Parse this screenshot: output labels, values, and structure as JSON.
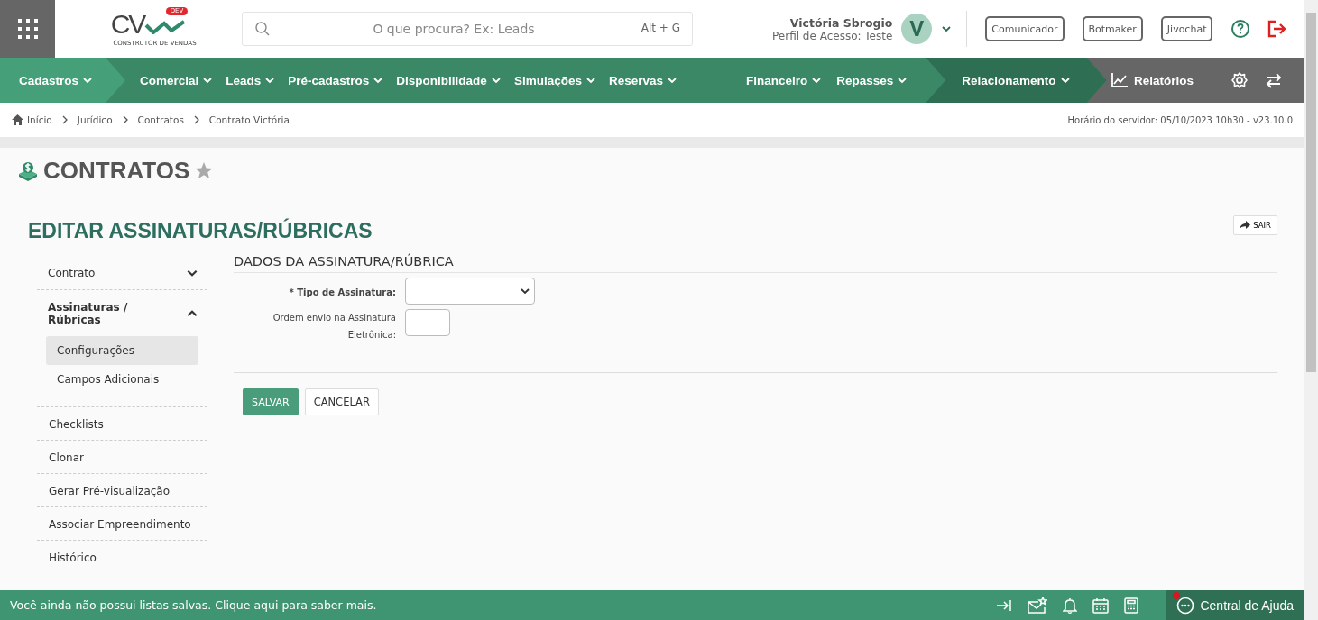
{
  "header": {
    "logo": {
      "text": "CV",
      "badge": "DEV",
      "caption": "CONSTRUTOR DE VENDAS"
    },
    "search": {
      "placeholder": "O que procura? Ex: Leads",
      "shortcut": "Alt + G"
    },
    "user": {
      "name": "Victória Sbrogio",
      "profile": "Perfil de Acesso: Teste",
      "initial": "V"
    },
    "buttons": [
      "Comunicador",
      "Botmaker",
      "Jivochat"
    ]
  },
  "nav": {
    "segments": [
      {
        "kind": "light",
        "items": [
          "Cadastros"
        ]
      },
      {
        "kind": "plain",
        "items": [
          "Comercial",
          "Leads",
          "Pré-cadastros",
          "Disponibilidade",
          "Simulações",
          "Reservas"
        ]
      },
      {
        "kind": "plain",
        "items": [
          "Financeiro",
          "Repasses"
        ]
      },
      {
        "kind": "dark",
        "items": [
          "Relacionamento"
        ]
      }
    ],
    "reports": "Relatórios"
  },
  "breadcrumb": [
    "Início",
    "Jurídico",
    "Contratos",
    "Contrato Victória"
  ],
  "server_time": "Horário do servidor: 05/10/2023 10h30 - v23.10.0",
  "page": {
    "title": "CONTRATOS",
    "favorite": false
  },
  "section": {
    "title": "EDITAR ASSINATURAS/RÚBRICAS",
    "exit": "SAIR"
  },
  "sidebar": {
    "items": [
      {
        "kind": "group",
        "label": "Contrato",
        "expanded": false
      },
      {
        "kind": "group",
        "label": "Assinaturas / Rúbricas",
        "expanded": true,
        "children": [
          {
            "label": "Configurações",
            "selected": true
          },
          {
            "label": "Campos Adicionais",
            "selected": false
          }
        ]
      },
      {
        "kind": "link",
        "label": "Checklists"
      },
      {
        "kind": "link",
        "label": "Clonar"
      },
      {
        "kind": "link",
        "label": "Gerar Pré-visualização"
      },
      {
        "kind": "link",
        "label": "Associar Empreendimento"
      },
      {
        "kind": "link",
        "label": "Histórico"
      }
    ]
  },
  "form": {
    "heading": "DADOS DA ASSINATURA/RÚBRICA",
    "fields": [
      {
        "kind": "select",
        "label": "* Tipo de Assinatura:",
        "required": true
      },
      {
        "kind": "number",
        "label": "Ordem envio na Assinatura Eletrônica:",
        "required": false
      }
    ],
    "save": "SALVAR",
    "cancel": "CANCELAR"
  },
  "footer": {
    "message": "Você ainda não possui listas salvas. Clique aqui para saber mais.",
    "help": "Central de Ajuda",
    "help_alert": true
  }
}
